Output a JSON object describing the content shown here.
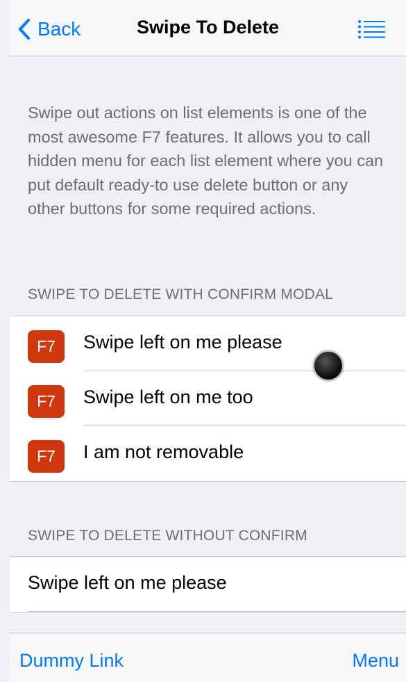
{
  "navbar": {
    "back_label": "Back",
    "title": "Swipe To Delete",
    "menu_icon": "list-icon"
  },
  "intro": {
    "text": "Swipe out actions on list elements is one of the most awesome F7 features. It allows you to call hidden menu for each list element where you can put default ready-to use delete button or any other buttons for some required actions."
  },
  "section1": {
    "title": "SWIPE TO DELETE WITH CONFIRM MODAL",
    "items": [
      {
        "badge": "F7",
        "label": "Swipe left on me please"
      },
      {
        "badge": "F7",
        "label": "Swipe left on me too"
      },
      {
        "badge": "F7",
        "label": "I am not removable"
      }
    ]
  },
  "section2": {
    "title": "SWIPE TO DELETE WITHOUT CONFIRM",
    "items": [
      {
        "label": "Swipe left on me please"
      }
    ]
  },
  "toolbar": {
    "left_link": "Dummy Link",
    "right_link": "Menu"
  },
  "colors": {
    "accent": "#007aff",
    "badge": "#d0370f",
    "background": "#efeff4"
  }
}
